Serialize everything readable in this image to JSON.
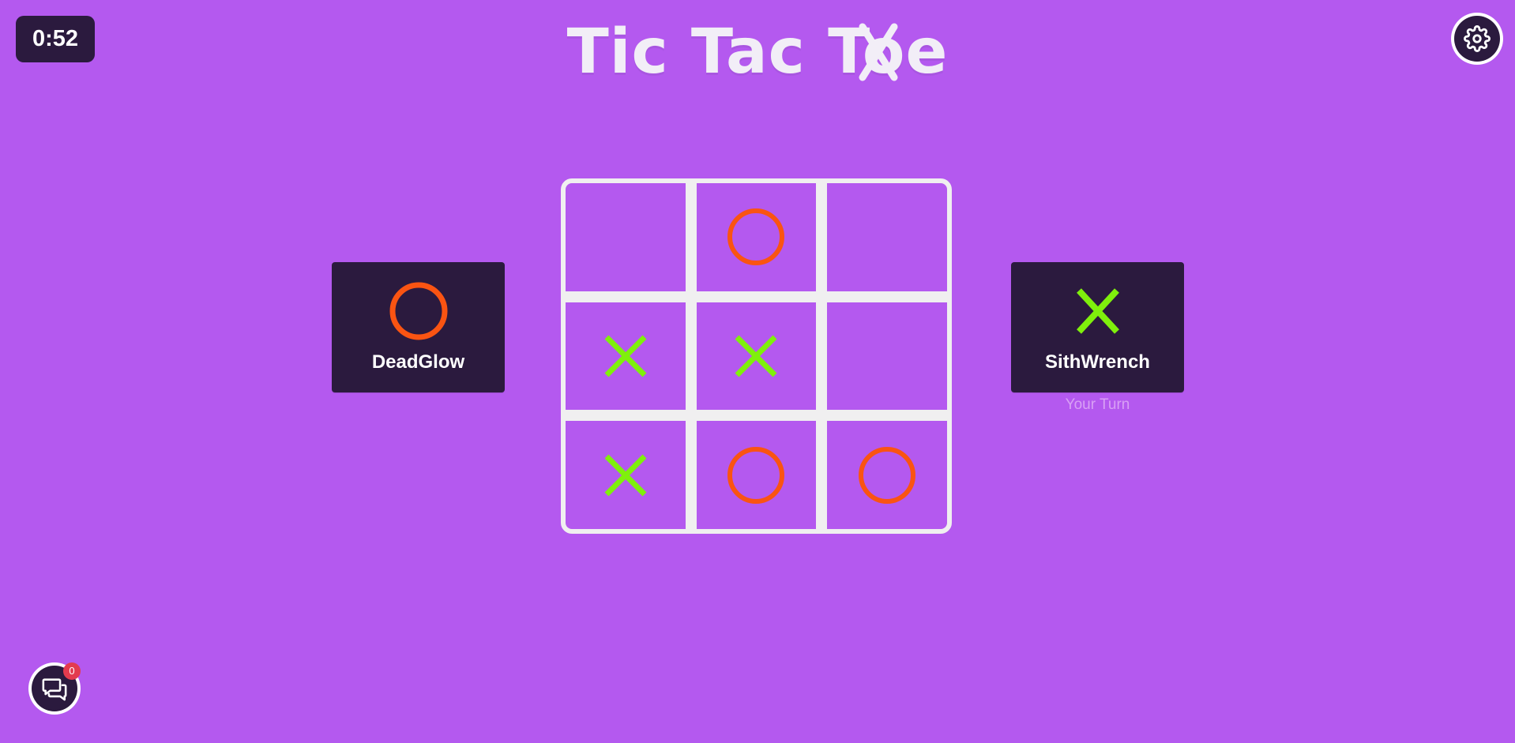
{
  "timer": "0:52",
  "title": "Tic Tac Toe",
  "colors": {
    "background": "#b459ef",
    "panel": "#2b1a3e",
    "x_mark": "#7ff00c",
    "o_mark": "#fa5412",
    "board_lines": "#f0eff0"
  },
  "players": {
    "left": {
      "name": "DeadGlow",
      "symbol": "O"
    },
    "right": {
      "name": "SithWrench",
      "symbol": "X",
      "status": "Your Turn"
    }
  },
  "board": [
    [
      "",
      "O",
      ""
    ],
    [
      "X",
      "X",
      ""
    ],
    [
      "X",
      "O",
      "O"
    ]
  ],
  "chat": {
    "unread_count": "0"
  },
  "icons": {
    "settings": "gear-icon",
    "chat": "chat-icon"
  }
}
